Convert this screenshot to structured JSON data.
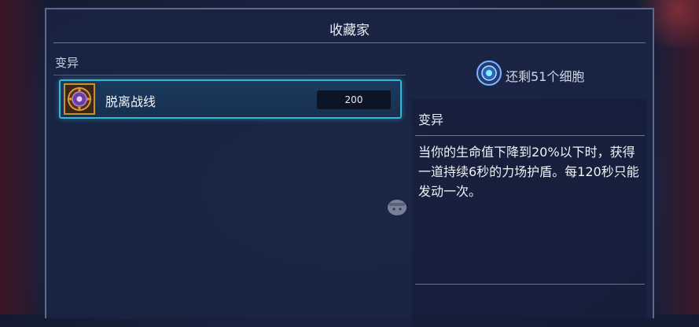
{
  "window": {
    "title": "收藏家"
  },
  "left_panel": {
    "section_label": "变异",
    "items": [
      {
        "name": "脱离战线",
        "cost": "200",
        "icon": "mutation-emblem-icon",
        "selected": true
      }
    ]
  },
  "right_panel": {
    "cells_text": "还剩51个细胞",
    "cells_icon": "cell-icon",
    "detail_title": "变异",
    "detail_body": "当你的生命值下降到20%以下时，获得一道持续6秒的力场护盾。每120秒只能发动一次。"
  },
  "colors": {
    "accent": "#2fb9d6",
    "frame": "#5f6a86",
    "icon_border": "#c9902e"
  }
}
